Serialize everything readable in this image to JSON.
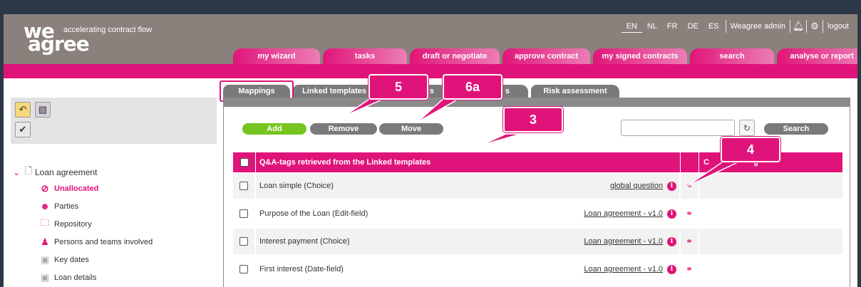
{
  "logo": {
    "we": "we",
    "agree": "agree",
    "tagline": "accelerating contract flow"
  },
  "topbar": {
    "languages": [
      "EN",
      "NL",
      "FR",
      "DE",
      "ES"
    ],
    "active_language": "EN",
    "user": "Weagree admin",
    "logout": "logout"
  },
  "nav": {
    "tabs": [
      {
        "label": "my wizard"
      },
      {
        "label": "tasks"
      },
      {
        "label": "draft or negotiate"
      },
      {
        "label": "approve contract"
      },
      {
        "label": "my signed contracts"
      },
      {
        "label": "search"
      },
      {
        "label": "analyse or report"
      }
    ]
  },
  "tree": {
    "root": "Loan agreement",
    "items": [
      {
        "label": "Unallocated",
        "icon": "ban-icon"
      },
      {
        "label": "Parties",
        "icon": "person-icon"
      },
      {
        "label": "Repository",
        "icon": "folder-icon"
      },
      {
        "label": "Persons and teams involved",
        "icon": "team-icon"
      },
      {
        "label": "Key dates",
        "icon": "cube-icon"
      },
      {
        "label": "Loan details",
        "icon": "cube-icon"
      }
    ]
  },
  "subtabs": [
    "Mappings",
    "Linked templates",
    "s",
    "s",
    "Risk assessment"
  ],
  "panel": {
    "add": "Add",
    "remove": "Remove",
    "move": "Move",
    "search_button": "Search",
    "search_value": ""
  },
  "table": {
    "header": "Q&A-tags retrieved from the Linked templates",
    "last_header_visible": "C",
    "last_header_tail": "g",
    "rows": [
      {
        "name": "Loan simple (Choice)",
        "source": "global question"
      },
      {
        "name": "Purpose of the Loan (Edit-field)",
        "source": "Loan agreement - v1.0"
      },
      {
        "name": "Interest payment (Choice)",
        "source": "Loan agreement - v1.0"
      },
      {
        "name": "First interest (Date-field)",
        "source": "Loan agreement - v1.0"
      }
    ]
  },
  "callouts": {
    "c5": "5",
    "c6a": "6a",
    "c3": "3",
    "c4": "4"
  },
  "colors": {
    "brand_pink": "#e0137a",
    "header_taupe": "#8b817c",
    "add_green": "#76c520",
    "button_gray": "#777777"
  }
}
